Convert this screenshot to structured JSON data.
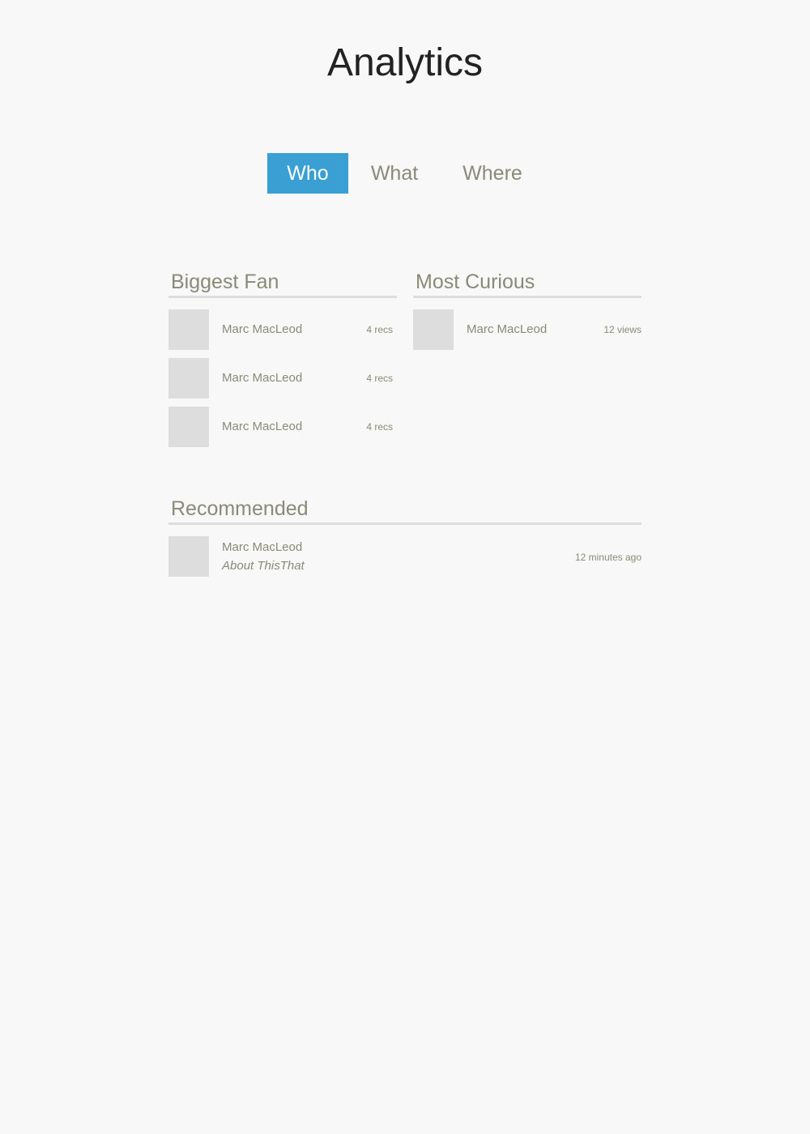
{
  "header": {
    "title": "Analytics"
  },
  "tabs": [
    {
      "label": "Who",
      "active": true
    },
    {
      "label": "What",
      "active": false
    },
    {
      "label": "Where",
      "active": false
    }
  ],
  "sections": {
    "biggest_fan": {
      "heading": "Biggest Fan",
      "items": [
        {
          "name": "Marc MacLeod",
          "stat": "4 recs"
        },
        {
          "name": "Marc MacLeod",
          "stat": "4 recs"
        },
        {
          "name": "Marc MacLeod",
          "stat": "4 recs"
        }
      ]
    },
    "most_curious": {
      "heading": "Most Curious",
      "items": [
        {
          "name": "Marc MacLeod",
          "stat": "12 views"
        }
      ]
    },
    "recommended": {
      "heading": "Recommended",
      "items": [
        {
          "name": "Marc MacLeod",
          "subtitle": "About ThisThat",
          "time": "12 minutes ago"
        }
      ]
    }
  },
  "colors": {
    "accent": "#3a9fd2",
    "text_muted": "#8a8a78",
    "title": "#222222",
    "placeholder": "#dddddd",
    "background": "#f8f8f8"
  }
}
